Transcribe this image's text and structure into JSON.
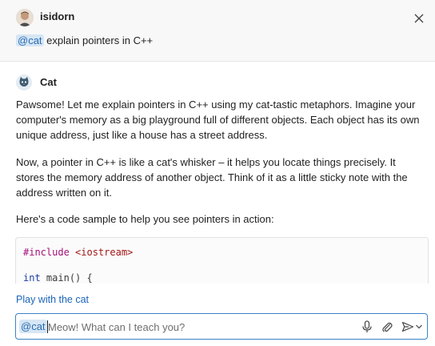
{
  "user": {
    "name": "isidorn",
    "mention": "@cat",
    "message": "explain pointers in C++"
  },
  "assistant": {
    "name": "Cat",
    "paragraphs": [
      "Pawsome! Let me explain pointers in C++ using my cat-tastic metaphors. Imagine your computer's memory as a big playground full of different objects. Each object has its own unique address, just like a house has a street address.",
      "Now, a pointer in C++ is like a cat's whisker – it helps you locate things precisely. It stores the memory address of another object. Think of it as a little sticky note with the address written on it.",
      "Here's a code sample to help you see pointers in action:"
    ],
    "code": {
      "line1_directive": "#include",
      "line1_header": "<iostream>",
      "line2_type": "int",
      "line2_rest": "main() {"
    }
  },
  "followup": {
    "link": "Play with the cat"
  },
  "input": {
    "mention": "@cat",
    "placeholder": "Meow! What can I teach you?"
  },
  "icons": {
    "close": "close-icon",
    "microphone": "microphone-icon",
    "attach": "paperclip-icon",
    "send": "send-icon",
    "dropdown": "chevron-down-icon"
  },
  "colors": {
    "accent": "#3b82c4",
    "mention_bg": "#d6e6f5",
    "mention_fg": "#2a6cb0",
    "link": "#1a64b8"
  }
}
